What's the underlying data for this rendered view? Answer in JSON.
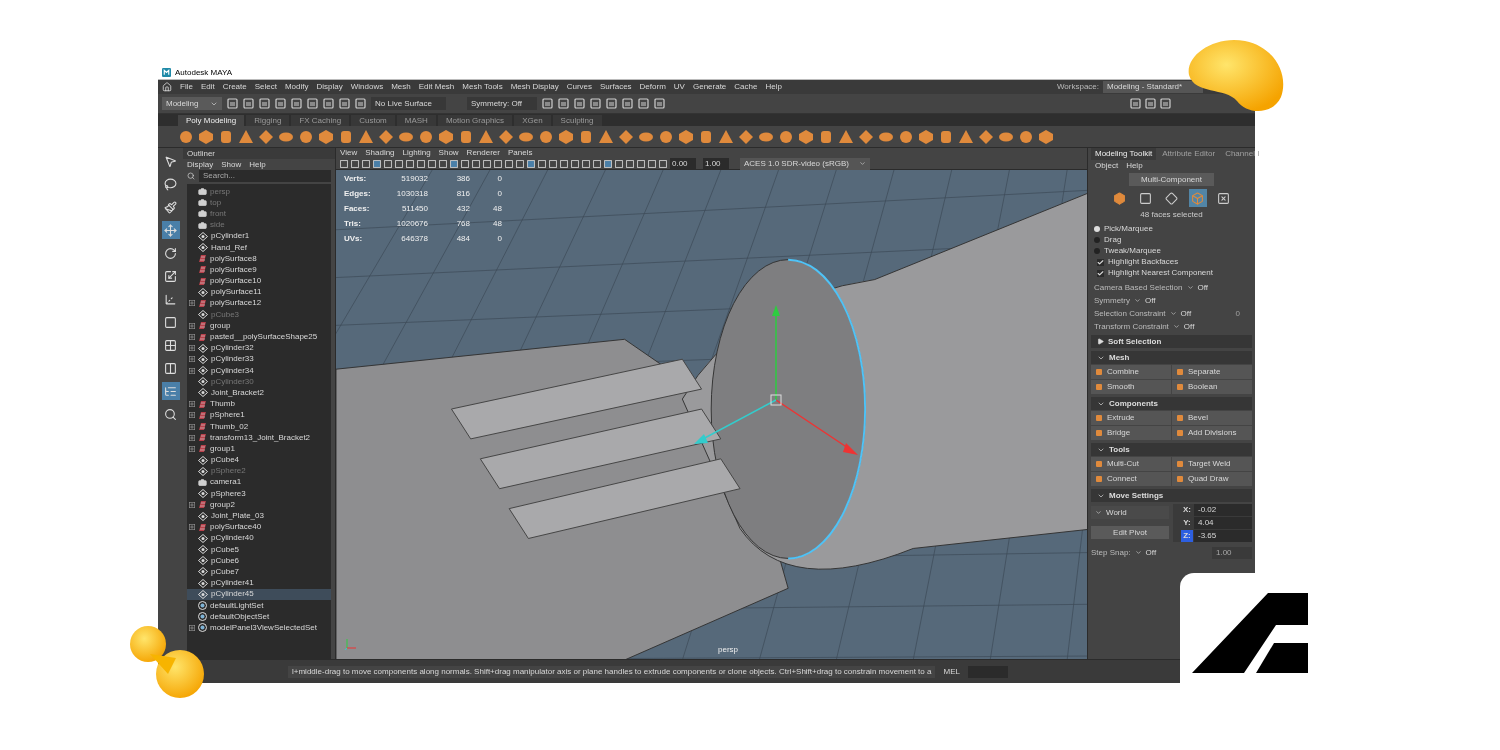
{
  "window": {
    "title": "Autodesk MAYA"
  },
  "menu_bar": [
    "File",
    "Edit",
    "Create",
    "Select",
    "Modify",
    "Display",
    "Windows",
    "Mesh",
    "Edit Mesh",
    "Mesh Tools",
    "Mesh Display",
    "Curves",
    "Surfaces",
    "Deform",
    "UV",
    "Generate",
    "Cache",
    "Help"
  ],
  "workspace": {
    "label": "Workspace:",
    "value": "Modeling - Standard*"
  },
  "status_line": {
    "mode": "Modeling",
    "live_surface": "No Live Surface",
    "symmetry": "Symmetry: Off"
  },
  "shelf_tabs": [
    {
      "label": "Poly Modeling",
      "selected": true
    },
    {
      "label": "Rigging",
      "selected": false
    },
    {
      "label": "FX Caching",
      "selected": false
    },
    {
      "label": "Custom",
      "selected": false
    },
    {
      "label": "MASH",
      "selected": false
    },
    {
      "label": "Motion Graphics",
      "selected": false
    },
    {
      "label": "XGen",
      "selected": false
    },
    {
      "label": "Sculpting",
      "selected": false
    }
  ],
  "toolbox": [
    {
      "kind": "select",
      "selected": false
    },
    {
      "kind": "lasso",
      "selected": false
    },
    {
      "kind": "paint",
      "selected": false
    },
    {
      "kind": "move",
      "selected": true
    },
    {
      "kind": "rotate",
      "selected": false
    },
    {
      "kind": "scale",
      "selected": false
    },
    {
      "kind": "axis",
      "selected": false
    },
    {
      "kind": "single",
      "selected": false
    },
    {
      "kind": "four",
      "selected": false
    },
    {
      "kind": "two",
      "selected": false
    },
    {
      "kind": "outliner",
      "selected": true
    },
    {
      "kind": "search",
      "selected": false
    }
  ],
  "outliner": {
    "title": "Outliner",
    "menu": [
      "Display",
      "Show",
      "Help"
    ],
    "search": {
      "placeholder": "Search..."
    },
    "items": [
      {
        "name": "persp",
        "kind": "camera",
        "has_children": false,
        "dimmed": true,
        "selected": false
      },
      {
        "name": "top",
        "kind": "camera",
        "has_children": false,
        "dimmed": true,
        "selected": false
      },
      {
        "name": "front",
        "kind": "camera",
        "has_children": false,
        "dimmed": true,
        "selected": false
      },
      {
        "name": "side",
        "kind": "camera",
        "has_children": false,
        "dimmed": true,
        "selected": false
      },
      {
        "name": "pCylinder1",
        "kind": "transform",
        "has_children": false,
        "dimmed": false,
        "selected": false
      },
      {
        "name": "Hand_Ref",
        "kind": "transform",
        "has_children": false,
        "dimmed": false,
        "selected": false
      },
      {
        "name": "polySurface8",
        "kind": "mesh",
        "has_children": false,
        "dimmed": false,
        "selected": false
      },
      {
        "name": "polySurface9",
        "kind": "mesh",
        "has_children": false,
        "dimmed": false,
        "selected": false
      },
      {
        "name": "polySurface10",
        "kind": "mesh",
        "has_children": false,
        "dimmed": false,
        "selected": false
      },
      {
        "name": "polySurface11",
        "kind": "transform",
        "has_children": false,
        "dimmed": false,
        "selected": false
      },
      {
        "name": "polySurface12",
        "kind": "mesh",
        "has_children": true,
        "dimmed": false,
        "selected": false
      },
      {
        "name": "pCube3",
        "kind": "transform",
        "has_children": false,
        "dimmed": true,
        "selected": false
      },
      {
        "name": "group",
        "kind": "mesh",
        "has_children": true,
        "dimmed": false,
        "selected": false
      },
      {
        "name": "pasted__polySurfaceShape25",
        "kind": "mesh",
        "has_children": true,
        "dimmed": false,
        "selected": false
      },
      {
        "name": "pCylinder32",
        "kind": "transform",
        "has_children": true,
        "dimmed": false,
        "selected": false
      },
      {
        "name": "pCylinder33",
        "kind": "transform",
        "has_children": true,
        "dimmed": false,
        "selected": false
      },
      {
        "name": "pCylinder34",
        "kind": "transform",
        "has_children": true,
        "dimmed": false,
        "selected": false
      },
      {
        "name": "pCylinder30",
        "kind": "transform",
        "has_children": false,
        "dimmed": true,
        "selected": false
      },
      {
        "name": "Joint_Bracket2",
        "kind": "transform",
        "has_children": false,
        "dimmed": false,
        "selected": false
      },
      {
        "name": "Thumb",
        "kind": "mesh",
        "has_children": true,
        "dimmed": false,
        "selected": false
      },
      {
        "name": "pSphere1",
        "kind": "mesh",
        "has_children": true,
        "dimmed": false,
        "selected": false
      },
      {
        "name": "Thumb_02",
        "kind": "mesh",
        "has_children": true,
        "dimmed": false,
        "selected": false
      },
      {
        "name": "transform13_Joint_Bracket2",
        "kind": "mesh",
        "has_children": true,
        "dimmed": false,
        "selected": false
      },
      {
        "name": "group1",
        "kind": "mesh",
        "has_children": true,
        "dimmed": false,
        "selected": false
      },
      {
        "name": "pCube4",
        "kind": "transform",
        "has_children": false,
        "dimmed": false,
        "selected": false
      },
      {
        "name": "pSphere2",
        "kind": "transform",
        "has_children": false,
        "dimmed": true,
        "selected": false
      },
      {
        "name": "camera1",
        "kind": "camera",
        "has_children": false,
        "dimmed": false,
        "selected": false
      },
      {
        "name": "pSphere3",
        "kind": "transform",
        "has_children": false,
        "dimmed": false,
        "selected": false
      },
      {
        "name": "group2",
        "kind": "mesh",
        "has_children": true,
        "dimmed": false,
        "selected": false
      },
      {
        "name": "Joint_Plate_03",
        "kind": "transform",
        "has_children": false,
        "dimmed": false,
        "selected": false
      },
      {
        "name": "polySurface40",
        "kind": "mesh",
        "has_children": true,
        "dimmed": false,
        "selected": false
      },
      {
        "name": "pCylinder40",
        "kind": "transform",
        "has_children": false,
        "dimmed": false,
        "selected": false
      },
      {
        "name": "pCube5",
        "kind": "transform",
        "has_children": false,
        "dimmed": false,
        "selected": false
      },
      {
        "name": "pCube6",
        "kind": "transform",
        "has_children": false,
        "dimmed": false,
        "selected": false
      },
      {
        "name": "pCube7",
        "kind": "transform",
        "has_children": false,
        "dimmed": false,
        "selected": false
      },
      {
        "name": "pCylinder41",
        "kind": "transform",
        "has_children": false,
        "dimmed": false,
        "selected": false
      },
      {
        "name": "pCylinder45",
        "kind": "transform",
        "has_children": false,
        "dimmed": false,
        "selected": true
      },
      {
        "name": "defaultLightSet",
        "kind": "set",
        "has_children": false,
        "dimmed": false,
        "selected": false
      },
      {
        "name": "defaultObjectSet",
        "kind": "set",
        "has_children": false,
        "dimmed": false,
        "selected": false
      },
      {
        "name": "modelPanel3ViewSelectedSet",
        "kind": "set",
        "has_children": true,
        "dimmed": false,
        "selected": false
      }
    ]
  },
  "viewport": {
    "menu": [
      "View",
      "Shading",
      "Lighting",
      "Show",
      "Renderer",
      "Panels"
    ],
    "exposure": "0.00",
    "gamma": "1.00",
    "color_space": "ACES 1.0 SDR-video (sRGB)",
    "hud": [
      {
        "label": "Verts:",
        "values": [
          "519032",
          "386",
          "0"
        ]
      },
      {
        "label": "Edges:",
        "values": [
          "1030318",
          "816",
          "0"
        ]
      },
      {
        "label": "Faces:",
        "values": [
          "511450",
          "432",
          "48"
        ]
      },
      {
        "label": "Tris:",
        "values": [
          "1020676",
          "768",
          "48"
        ]
      },
      {
        "label": "UVs:",
        "values": [
          "646378",
          "484",
          "0"
        ]
      }
    ],
    "camera": "persp"
  },
  "toolkit": {
    "tabs": [
      {
        "label": "Modeling Toolkit",
        "selected": true
      },
      {
        "label": "Attribute Editor",
        "selected": false
      },
      {
        "label": "Channel I",
        "selected": false
      }
    ],
    "menu": [
      "Object",
      "Help"
    ],
    "mode_button": "Multi-Component",
    "component_modes": [
      {
        "kind": "object",
        "selected": false
      },
      {
        "kind": "vertex",
        "selected": false
      },
      {
        "kind": "edge",
        "selected": false
      },
      {
        "kind": "face",
        "selected": true
      },
      {
        "kind": "uv",
        "selected": false
      }
    ],
    "selection_info": "48 faces selected",
    "pick_modes": [
      {
        "label": "Pick/Marquee",
        "selected": true
      },
      {
        "label": "Drag",
        "selected": false
      },
      {
        "label": "Tweak/Marquee",
        "selected": false
      }
    ],
    "options": [
      {
        "label": "Highlight Backfaces",
        "checked": true
      },
      {
        "label": "Highlight Nearest Component",
        "checked": true
      }
    ],
    "settings": [
      {
        "label": "Camera Based Selection",
        "value": "Off"
      },
      {
        "label": "Symmetry",
        "value": "Off"
      },
      {
        "label": "Selection Constraint",
        "value": "Off",
        "extra": "0"
      },
      {
        "label": "Transform Constraint",
        "value": "Off"
      }
    ],
    "sections": [
      {
        "title": "Soft Selection",
        "expanded": false
      },
      {
        "title": "Mesh",
        "expanded": true,
        "buttons": [
          "Combine",
          "Separate",
          "Smooth",
          "Boolean"
        ]
      },
      {
        "title": "Components",
        "expanded": true,
        "buttons": [
          "Extrude",
          "Bevel",
          "Bridge",
          "Add Divisions"
        ]
      },
      {
        "title": "Tools",
        "expanded": true,
        "buttons": [
          "Multi-Cut",
          "Target Weld",
          "Connect",
          "Quad Draw"
        ]
      }
    ],
    "move_settings": {
      "title": "Move Settings",
      "expanded": true,
      "space": "World",
      "edit_pivot": "Edit Pivot",
      "coords": [
        {
          "axis": "X:",
          "value": "-0.02",
          "selected": false
        },
        {
          "axis": "Y:",
          "value": "4.04",
          "selected": false
        },
        {
          "axis": "Z:",
          "value": "-3.65",
          "selected": true
        }
      ],
      "step_snap": {
        "label": "Step Snap:",
        "value": "Off",
        "amount": "1.00"
      }
    }
  },
  "status_bar": {
    "help": "l+middle-drag to move components along normals. Shift+drag manipulator axis or plane handles to extrude components or clone objects. Ctrl+Shift+drag to constrain movement to a",
    "command_type": "MEL"
  }
}
